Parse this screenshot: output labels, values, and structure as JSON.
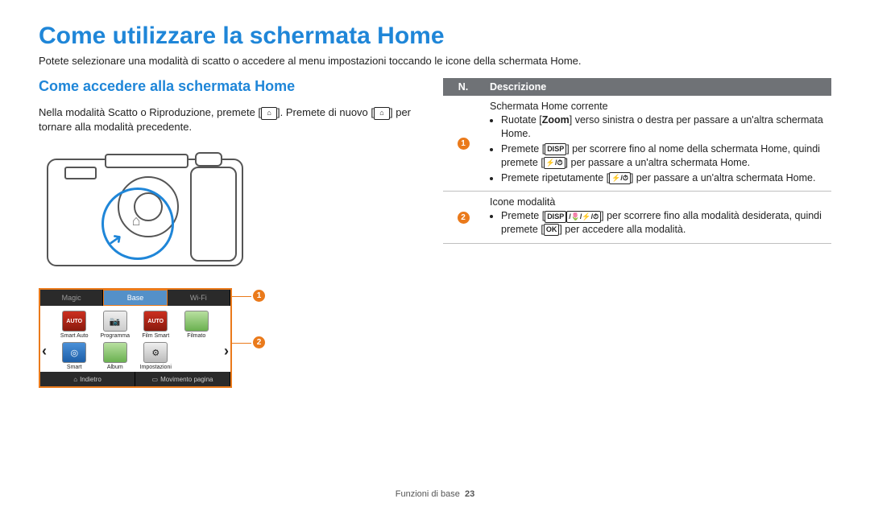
{
  "title": "Come utilizzare la schermata Home",
  "intro": "Potete selezionare una modalità di scatto o accedere al menu impostazioni toccando le icone della schermata Home.",
  "section_heading": "Come accedere alla schermata Home",
  "body_prefix": "Nella modalità Scatto o Riproduzione, premete [",
  "body_mid": "]. Premete di nuovo [",
  "body_suffix": "] per tornare alla modalità precedente.",
  "home_glyph": "⌂",
  "zoom_label": "Zoom",
  "disp_label": "DISP",
  "ok_label": "OK",
  "tabs": {
    "magic": "Magic",
    "base": "Base",
    "wifi": "Wi-Fi"
  },
  "apps": {
    "smart_auto": "Smart Auto",
    "programma": "Programma",
    "film_smart": "Film Smart",
    "filmato": "Filmato",
    "smart": "Smart",
    "album": "Album",
    "impostazioni": "Impostazioni"
  },
  "bottom": {
    "indietro": "Indietro",
    "movimento": "Movimento pagina"
  },
  "callouts": {
    "c1": "1",
    "c2": "2"
  },
  "table": {
    "head_n": "N.",
    "head_desc": "Descrizione",
    "row1": {
      "title": "Schermata Home corrente",
      "b1a": "Ruotate [",
      "b1b": "] verso sinistra o destra per passare a un'altra schermata Home.",
      "b2a": "Premete [",
      "b2b": "] per scorrere fino al nome della schermata Home, quindi premete [",
      "b2c": "] per passare a un'altra schermata Home.",
      "b3a": "Premete ripetutamente [",
      "b3b": "] per passare a un'altra schermata Home."
    },
    "row2": {
      "title": "Icone modalità",
      "b1a": "Premete [",
      "b1b": "] per scorrere fino alla modalità desiderata, quindi premete [",
      "b1c": "] per accedere alla modalità."
    },
    "flash_timer_glyph": "⚡/⏱",
    "disp_macro_flash_timer_glyph": "/🌷/⚡/⏱"
  },
  "footer": {
    "label": "Funzioni di base",
    "page": "23"
  }
}
